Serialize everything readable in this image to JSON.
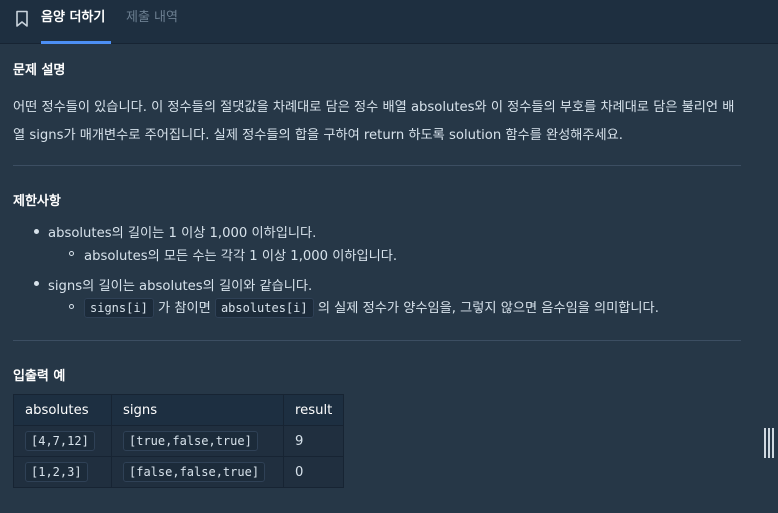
{
  "tabs": [
    {
      "label": "음양 더하기",
      "active": true
    },
    {
      "label": "제출 내역",
      "active": false
    }
  ],
  "problem": {
    "title": "문제 설명",
    "description": "어떤 정수들이 있습니다. 이 정수들의 절댓값을 차례대로 담은 정수 배열 absolutes와 이 정수들의 부호를 차례대로 담은 불리언 배열 signs가 매개변수로 주어집니다. 실제 정수들의 합을 구하여 return 하도록 solution 함수를 완성해주세요."
  },
  "constraints": {
    "title": "제한사항",
    "items": [
      {
        "text": "absolutes의 길이는 1 이상 1,000 이하입니다.",
        "sub": "absolutes의 모든 수는 각각 1 이상 1,000 이하입니다."
      },
      {
        "text": "signs의 길이는 absolutes의 길이와 같습니다.",
        "sub_code1": "signs[i]",
        "sub_mid": "가 참이면",
        "sub_code2": "absolutes[i]",
        "sub_end": "의 실제 정수가 양수임을, 그렇지 않으면 음수임을 의미합니다."
      }
    ]
  },
  "examples": {
    "title": "입출력 예",
    "headers": [
      "absolutes",
      "signs",
      "result"
    ],
    "rows": [
      [
        "[4,7,12]",
        "[true,false,true]",
        "9"
      ],
      [
        "[1,2,3]",
        "[false,false,true]",
        "0"
      ]
    ]
  },
  "colors": {
    "background": "#263747",
    "tab_bar": "#1e2f40",
    "accent": "#4c8ff5"
  },
  "icons": {
    "bookmark": "bookmark-icon",
    "scroll_handle": "resize-handle-icon"
  }
}
